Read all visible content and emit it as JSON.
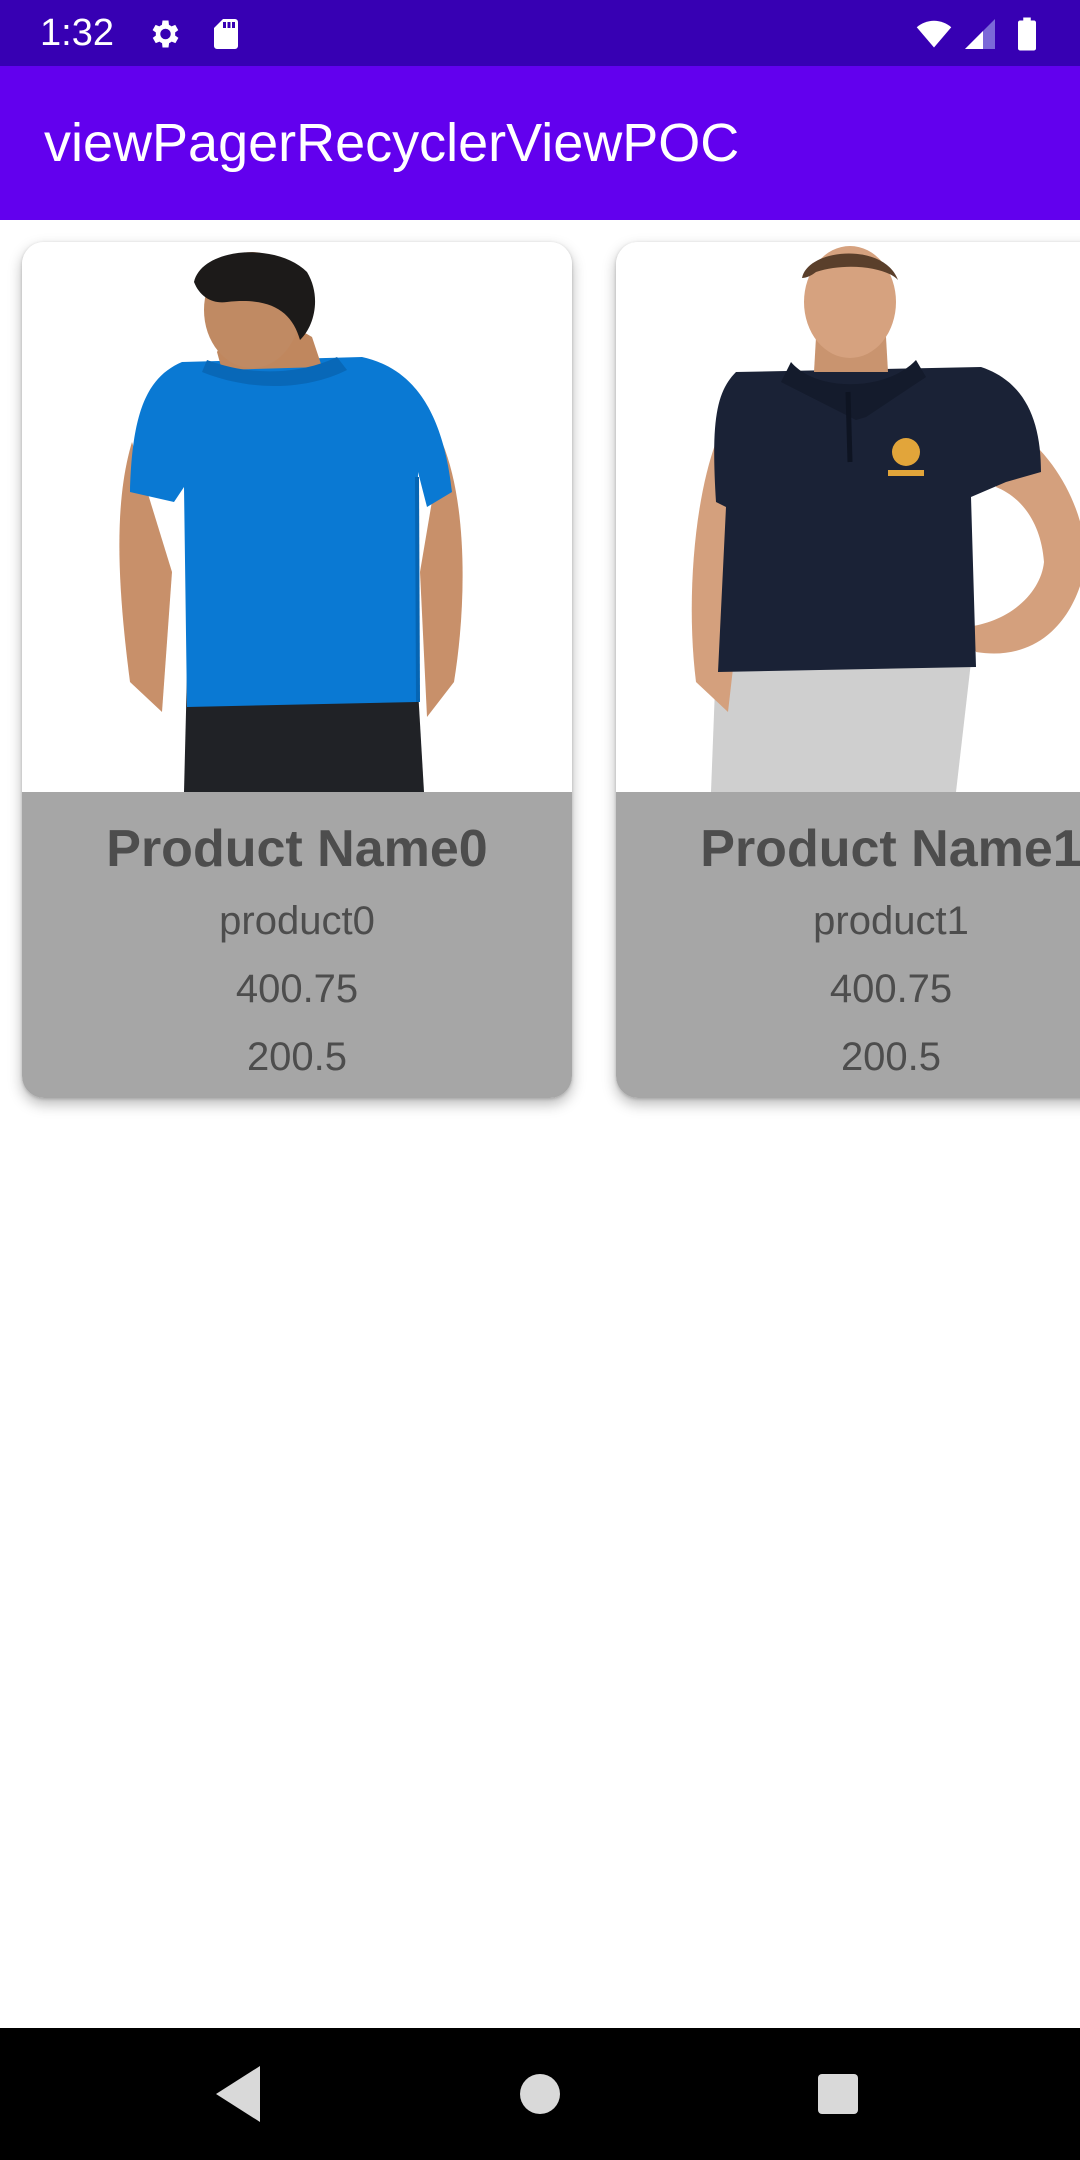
{
  "status_bar": {
    "time": "1:32",
    "icons": [
      "gear-icon",
      "sd-card-icon",
      "wifi-icon",
      "signal-icon",
      "battery-icon"
    ],
    "background": "#3700b3"
  },
  "app_bar": {
    "title": "viewPagerRecyclerViewPOC",
    "background": "#6200ee"
  },
  "products": [
    {
      "name": "Product Name0",
      "description": "product0",
      "price": "400.75",
      "discount_price": "200.5",
      "image": "blue-polo-shirt-back-view"
    },
    {
      "name": "Product Name1",
      "description": "product1",
      "price": "400.75",
      "discount_price": "200.5",
      "image": "navy-polo-shirt-front-view"
    }
  ],
  "colors": {
    "info_panel": "#a6a6a6",
    "text": "#4d4d4d"
  },
  "nav_bar": {
    "icons": [
      "back-icon",
      "home-icon",
      "recents-icon"
    ]
  }
}
